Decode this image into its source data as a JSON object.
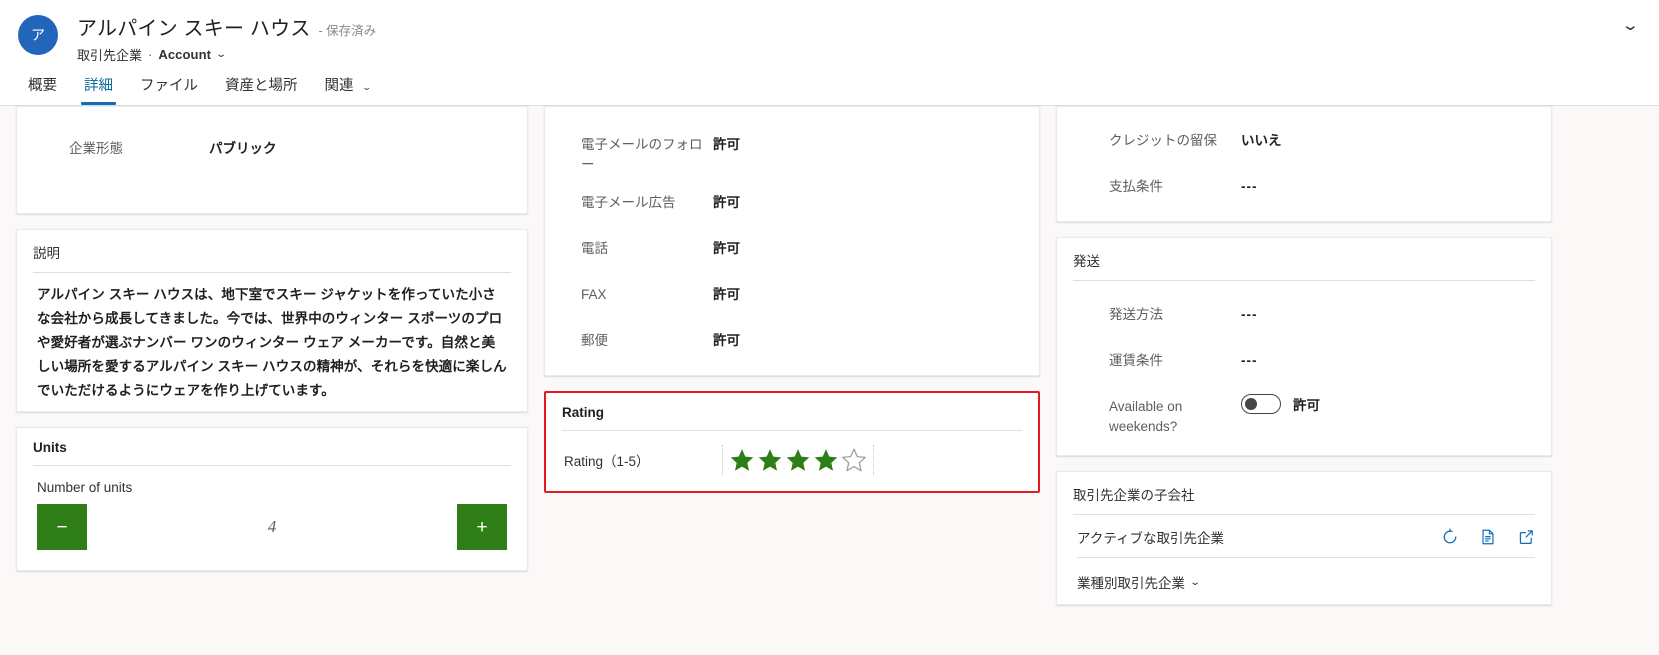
{
  "header": {
    "avatar_initial": "ア",
    "record_title": "アルパイン スキー ハウス",
    "saved_state": "- 保存済み",
    "entity_label": "取引先企業",
    "separator": "·",
    "entity_type": "Account",
    "entity_chevron": "⌄",
    "collapse_chevron": "⌄"
  },
  "tabs": [
    {
      "label": "概要",
      "active": false,
      "chevron": ""
    },
    {
      "label": "詳細",
      "active": true,
      "chevron": ""
    },
    {
      "label": "ファイル",
      "active": false,
      "chevron": ""
    },
    {
      "label": "資産と場所",
      "active": false,
      "chevron": ""
    },
    {
      "label": "関連",
      "active": false,
      "chevron": "⌄"
    }
  ],
  "left_column": {
    "company_form": {
      "label": "企業形態",
      "value": "パブリック"
    },
    "description_card": {
      "title": "説明",
      "text": "アルパイン スキー ハウスは、地下室でスキー ジャケットを作っていた小さな会社から成長してきました。今では、世界中のウィンター スポーツのプロや愛好者が選ぶナンバー ワンのウィンター ウェア メーカーです。自然と美しい場所を愛するアルパイン スキー ハウスの精神が、それらを快適に楽しんでいただけるようにウェアを作り上げています。"
    },
    "units_card": {
      "title": "Units",
      "field_label": "Number of units",
      "decrement_label": "−",
      "increment_label": "+",
      "value": "4"
    }
  },
  "middle_column": {
    "contact_prefs": [
      {
        "label": "電子メールのフォロー",
        "value": "許可"
      },
      {
        "label": "電子メール広告",
        "value": "許可"
      },
      {
        "label": "電話",
        "value": "許可"
      },
      {
        "label": "FAX",
        "value": "許可"
      },
      {
        "label": "郵便",
        "value": "許可"
      }
    ],
    "rating_card": {
      "title": "Rating",
      "field_label": "Rating（1-5）",
      "value": 4,
      "max": 5,
      "filled_color": "#2e7d16",
      "empty_color": "#a19f9d",
      "highlight_color": "#e01b24"
    }
  },
  "right_column": {
    "credit_card_fields": [
      {
        "label": "クレジットの留保",
        "value": "いいえ"
      },
      {
        "label": "支払条件",
        "value": "---"
      }
    ],
    "shipping_card": {
      "title": "発送",
      "fields": [
        {
          "label": "発送方法",
          "value": "---"
        },
        {
          "label": "運賃条件",
          "value": "---"
        }
      ],
      "toggle_field": {
        "label": "Available on weekends?",
        "state_label": "許可",
        "on": false
      }
    },
    "subsidiaries_card": {
      "title": "取引先企業の子会社",
      "grid_label": "アクティブな取引先企業",
      "actions": [
        {
          "icon": "refresh-icon"
        },
        {
          "icon": "report-icon"
        },
        {
          "icon": "popout-icon"
        }
      ],
      "filter_label": "業種別取引先企業",
      "filter_chevron": "⌄"
    }
  },
  "colors": {
    "accent": "#0f6cbd",
    "green": "#2e7d16",
    "highlight_red": "#e01b24",
    "avatar_blue": "#2266bb"
  }
}
